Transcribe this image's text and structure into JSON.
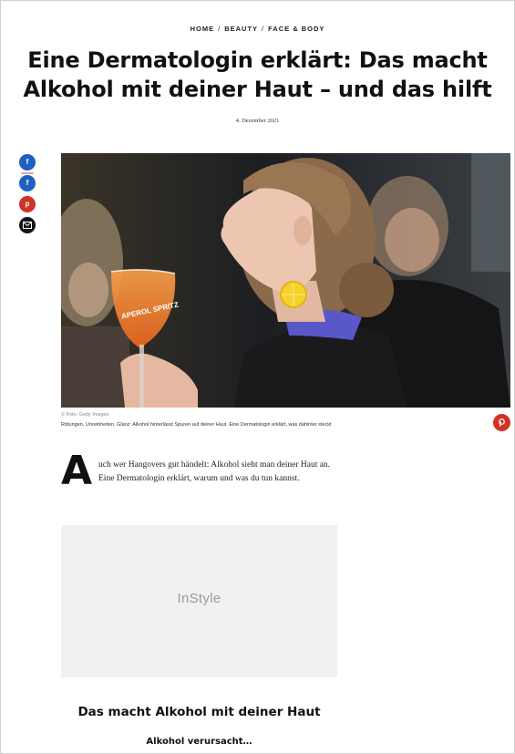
{
  "breadcrumb": {
    "items": [
      "HOME",
      "BEAUTY",
      "FACE & BODY"
    ],
    "separator": "/"
  },
  "article": {
    "title": "Eine Dermatologin erklärt: Das macht Alkohol mit deiner Haut – und das hilft",
    "date": "4. Dezember 2021",
    "image_credit": "© Foto: Getty Images",
    "image_caption": "Rötungen, Unreinheiten, Glanz: Alkohol hinterlässt Spuren auf deiner Haut. Eine Dermatologin erklärt, was dahinter steckt",
    "drop_cap": "A",
    "lead": "uch wer Hangovers gut händelt: Alkohol sieht man deiner Haut an. Eine Dermatologin erklärt, warum und was du tun kannst.",
    "section_heading": "Das macht Alkohol mit deiner Haut",
    "sub_heading": "Alkohol verursacht…"
  },
  "share": {
    "icons": [
      "facebook-icon",
      "facebook-icon",
      "pinterest-icon",
      "mail-icon"
    ],
    "colors": {
      "facebook": "#1f5fbf",
      "pinterest": "#cf3324",
      "mail": "#141414"
    },
    "fb_glyph": "f",
    "pin_glyph": "p"
  },
  "ad": {
    "logo_text": "InStyle",
    "background": "#f1f1f1"
  },
  "hero": {
    "glass_brand": "APEROL SPRITZ"
  }
}
